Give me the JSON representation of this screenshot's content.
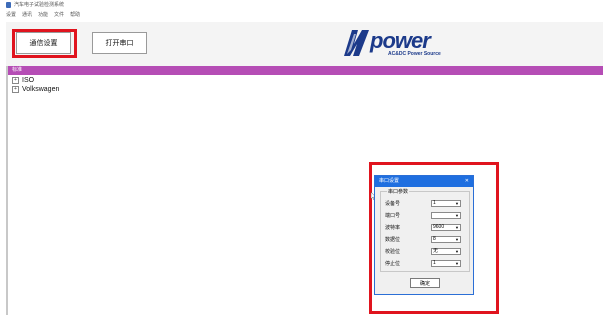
{
  "title_bar": {
    "title": "汽车电子试验检测系统"
  },
  "menu": [
    "设置",
    "通讯",
    "功能",
    "文件",
    "帮助"
  ],
  "toolbar": {
    "settings_label": "通信设置",
    "open_port_label": "打开串口"
  },
  "logo": {
    "text": "power",
    "subtitle": "AC&DC Power Source"
  },
  "tree": {
    "header": "标准",
    "items": [
      {
        "label": "ISO",
        "expander": "+"
      },
      {
        "label": "Volkswagen",
        "expander": "+"
      }
    ]
  },
  "dialog": {
    "title": "串口设置",
    "close": "✕",
    "group_title": "串口参数",
    "fields": [
      {
        "label": "设备号",
        "value": "1"
      },
      {
        "label": "端口号",
        "value": ""
      },
      {
        "label": "波特率",
        "value": "9600"
      },
      {
        "label": "数据位",
        "value": "8"
      },
      {
        "label": "校验位",
        "value": "无"
      },
      {
        "label": "停止位",
        "value": "1"
      }
    ],
    "ok_label": "确定"
  },
  "colors": {
    "highlight": "#e0141e",
    "tree_header": "#b54db5",
    "dialog_title": "#1f6fe0",
    "logo": "#1c3a8a"
  }
}
